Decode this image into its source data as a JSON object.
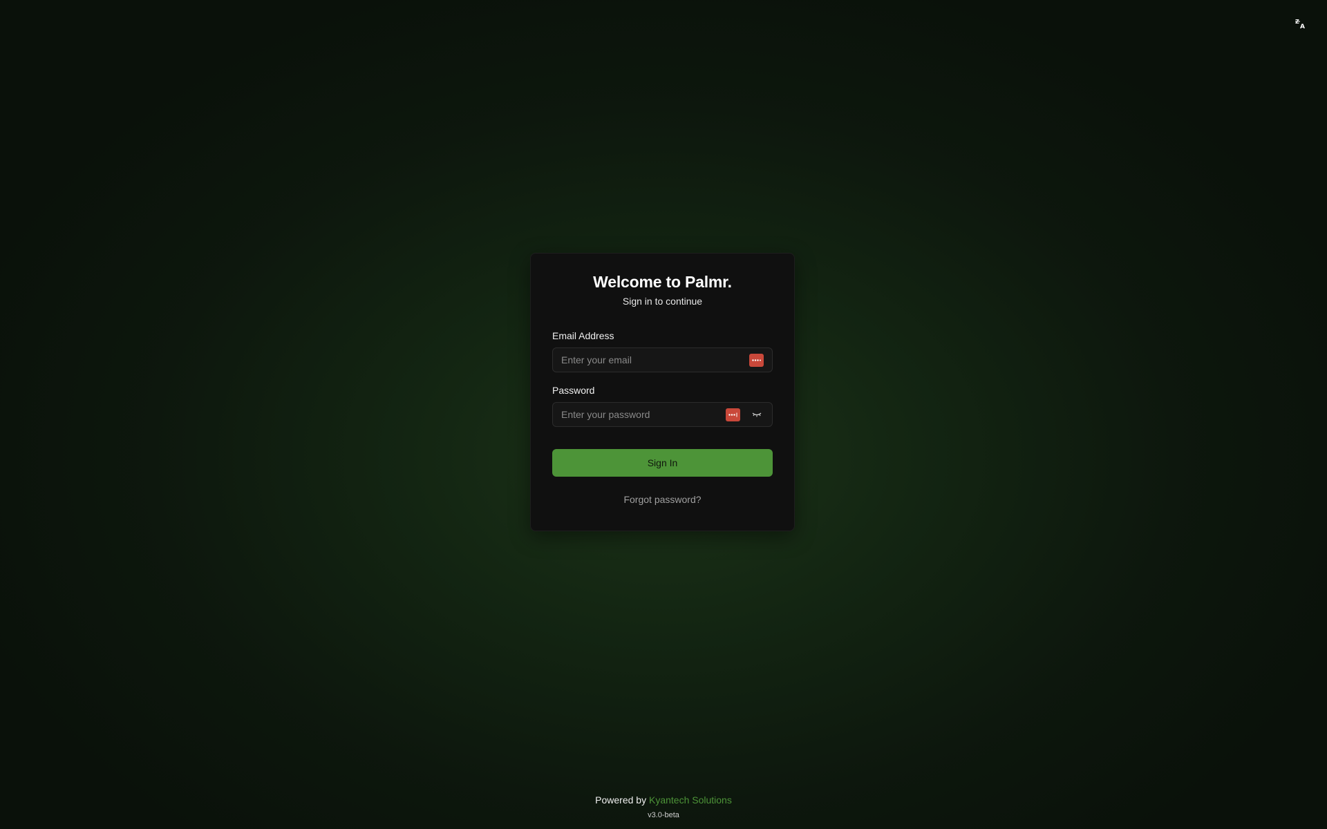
{
  "header": {
    "language_icon": "translate-icon"
  },
  "login": {
    "title": "Welcome to Palmr.",
    "subtitle": "Sign in to continue",
    "email": {
      "label": "Email Address",
      "placeholder": "Enter your email",
      "value": ""
    },
    "password": {
      "label": "Password",
      "placeholder": "Enter your password",
      "value": ""
    },
    "submit_label": "Sign In",
    "forgot_label": "Forgot password?"
  },
  "footer": {
    "powered_by": "Powered by",
    "company": "Kyantech Solutions",
    "version": "v3.0-beta"
  },
  "colors": {
    "accent": "#4d9438",
    "password_manager": "#c9483a"
  }
}
